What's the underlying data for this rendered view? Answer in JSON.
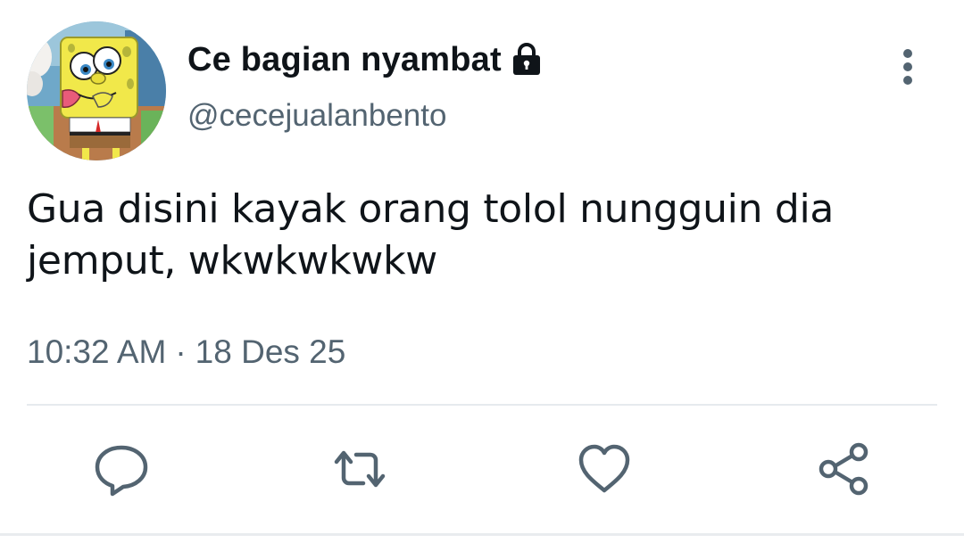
{
  "tweet": {
    "display_name": "Ce bagian nyambat",
    "handle": "@cecejualanbento",
    "text": "Gua disini kayak orang tolol nungguin dia\njemput, wkwkwkwkw",
    "time": "10:32 AM",
    "separator": "·",
    "date": "18 Des 25"
  },
  "icons": {
    "protected": "lock-icon",
    "more": "more-vertical-icon",
    "reply": "reply-icon",
    "retweet": "retweet-icon",
    "like": "heart-icon",
    "share": "share-icon"
  },
  "colors": {
    "text_primary": "#0f1419",
    "text_secondary": "#536471",
    "divider": "#e6eaee"
  }
}
